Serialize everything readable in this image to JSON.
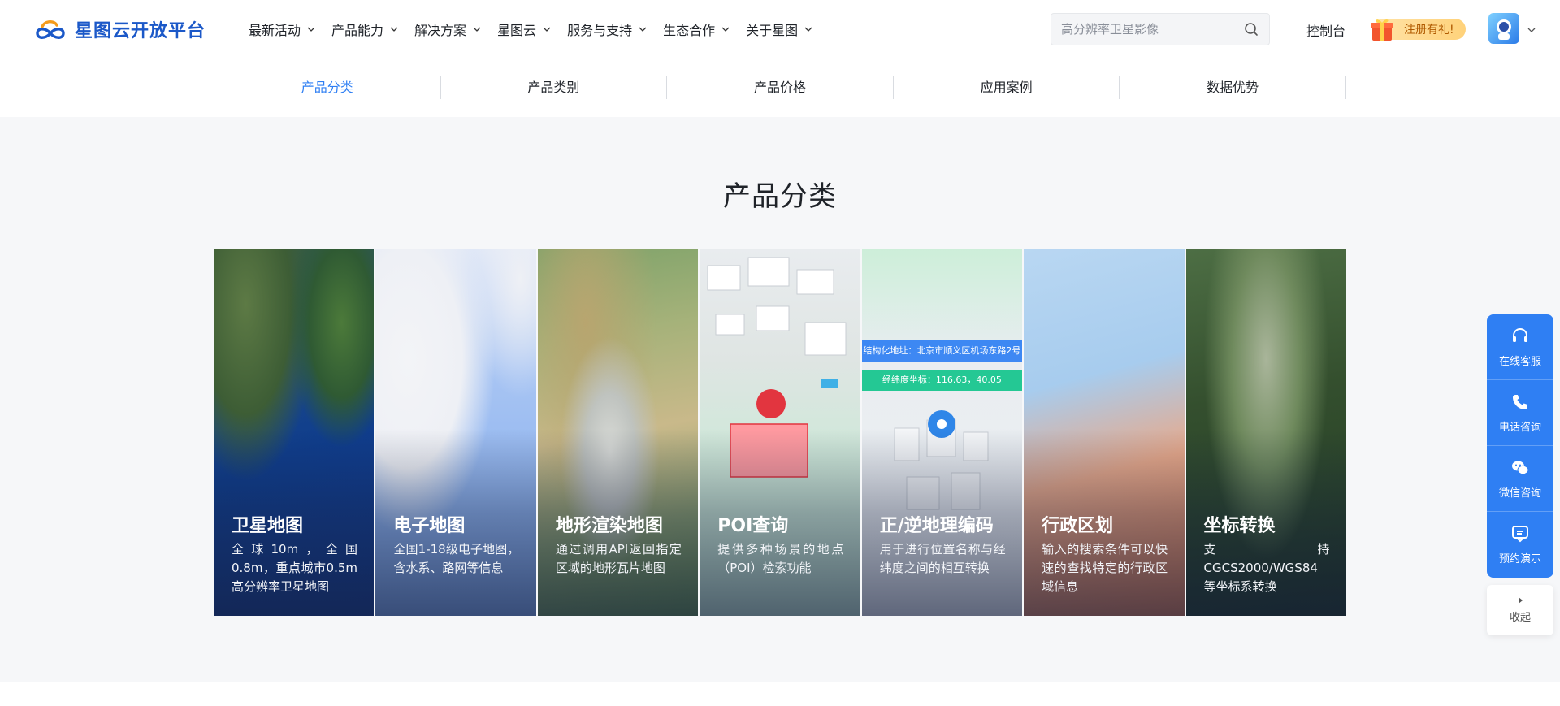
{
  "brand": {
    "logo_text": "星图云开放平台",
    "logo_icon": "cloud-infinity-logo"
  },
  "nav": {
    "items": [
      {
        "label": "最新活动"
      },
      {
        "label": "产品能力"
      },
      {
        "label": "解决方案"
      },
      {
        "label": "星图云"
      },
      {
        "label": "服务与支持"
      },
      {
        "label": "生态合作"
      },
      {
        "label": "关于星图"
      }
    ]
  },
  "search": {
    "placeholder": "高分辨率卫星影像",
    "icon": "search-icon"
  },
  "header": {
    "console_label": "控制台",
    "promo_label": "注册有礼!",
    "promo_icon": "gift-icon",
    "avatar_icon": "user-avatar"
  },
  "subnav": {
    "items": [
      {
        "label": "产品分类",
        "active": true
      },
      {
        "label": "产品类别"
      },
      {
        "label": "产品价格"
      },
      {
        "label": "应用案例"
      },
      {
        "label": "数据优势"
      }
    ]
  },
  "section": {
    "title": "产品分类"
  },
  "cards": [
    {
      "title": "卫星地图",
      "desc": "全球10m，全国0.8m，重点城市0.5m高分辨率卫星地图"
    },
    {
      "title": "电子地图",
      "desc": "全国1-18级电子地图，含水系、路网等信息"
    },
    {
      "title": "地形渲染地图",
      "desc": "通过调用API返回指定区域的地形瓦片地图"
    },
    {
      "title": "POI查询",
      "desc": "提供多种场景的地点（POI）检索功能"
    },
    {
      "title": "正/逆地理编码",
      "desc": "用于进行位置名称与经纬度之间的相互转换",
      "tag_address": "结构化地址：北京市顺义区机场东路2号",
      "tag_coords": "经纬度坐标：116.63，40.05"
    },
    {
      "title": "行政区划",
      "desc": "输入的搜索条件可以快速的查找特定的行政区域信息"
    },
    {
      "title": "坐标转换",
      "desc": "支持CGCS2000/WGS84等坐标系转换"
    }
  ],
  "float_bar": {
    "items": [
      {
        "label": "在线客服",
        "icon": "headset-icon"
      },
      {
        "label": "电话咨询",
        "icon": "phone-icon"
      },
      {
        "label": "微信咨询",
        "icon": "wechat-icon"
      },
      {
        "label": "预约演示",
        "icon": "chat-box-icon"
      }
    ],
    "collapse_label": "收起"
  },
  "colors": {
    "accent": "#2f7ff3",
    "brand": "#1b58c8",
    "section_bg": "#f6f7f9"
  }
}
